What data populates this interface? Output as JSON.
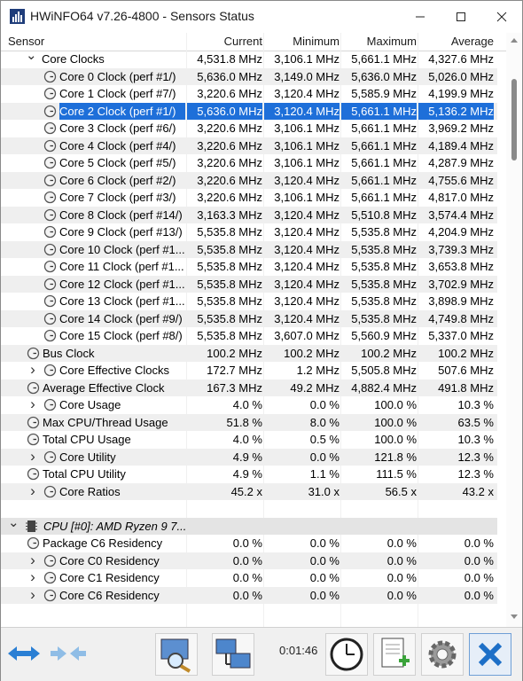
{
  "window": {
    "title": "HWiNFO64 v7.26-4800 - Sensors Status"
  },
  "columns": {
    "sensor": "Sensor",
    "current": "Current",
    "minimum": "Minimum",
    "maximum": "Maximum",
    "average": "Average"
  },
  "rows": [
    {
      "name": "Core Clocks",
      "cur": "4,531.8 MHz",
      "min": "3,106.1 MHz",
      "max": "5,661.1 MHz",
      "avg": "4,327.6 MHz"
    },
    {
      "name": "Core 0 Clock (perf #1/)",
      "cur": "5,636.0 MHz",
      "min": "3,149.0 MHz",
      "max": "5,636.0 MHz",
      "avg": "5,026.0 MHz"
    },
    {
      "name": "Core 1 Clock (perf #7/)",
      "cur": "3,220.6 MHz",
      "min": "3,120.4 MHz",
      "max": "5,585.9 MHz",
      "avg": "4,199.9 MHz"
    },
    {
      "name": "Core 2 Clock (perf #1/)",
      "cur": "5,636.0 MHz",
      "min": "3,120.4 MHz",
      "max": "5,661.1 MHz",
      "avg": "5,136.2 MHz"
    },
    {
      "name": "Core 3 Clock (perf #6/)",
      "cur": "3,220.6 MHz",
      "min": "3,106.1 MHz",
      "max": "5,661.1 MHz",
      "avg": "3,969.2 MHz"
    },
    {
      "name": "Core 4 Clock (perf #4/)",
      "cur": "3,220.6 MHz",
      "min": "3,106.1 MHz",
      "max": "5,661.1 MHz",
      "avg": "4,189.4 MHz"
    },
    {
      "name": "Core 5 Clock (perf #5/)",
      "cur": "3,220.6 MHz",
      "min": "3,106.1 MHz",
      "max": "5,661.1 MHz",
      "avg": "4,287.9 MHz"
    },
    {
      "name": "Core 6 Clock (perf #2/)",
      "cur": "3,220.6 MHz",
      "min": "3,120.4 MHz",
      "max": "5,661.1 MHz",
      "avg": "4,755.6 MHz"
    },
    {
      "name": "Core 7 Clock (perf #3/)",
      "cur": "3,220.6 MHz",
      "min": "3,106.1 MHz",
      "max": "5,661.1 MHz",
      "avg": "4,817.0 MHz"
    },
    {
      "name": "Core 8 Clock (perf #14/)",
      "cur": "3,163.3 MHz",
      "min": "3,120.4 MHz",
      "max": "5,510.8 MHz",
      "avg": "3,574.4 MHz"
    },
    {
      "name": "Core 9 Clock (perf #13/)",
      "cur": "5,535.8 MHz",
      "min": "3,120.4 MHz",
      "max": "5,535.8 MHz",
      "avg": "4,204.9 MHz"
    },
    {
      "name": "Core 10 Clock (perf #1...",
      "cur": "5,535.8 MHz",
      "min": "3,120.4 MHz",
      "max": "5,535.8 MHz",
      "avg": "3,739.3 MHz"
    },
    {
      "name": "Core 11 Clock (perf #1...",
      "cur": "5,535.8 MHz",
      "min": "3,120.4 MHz",
      "max": "5,535.8 MHz",
      "avg": "3,653.8 MHz"
    },
    {
      "name": "Core 12 Clock (perf #1...",
      "cur": "5,535.8 MHz",
      "min": "3,120.4 MHz",
      "max": "5,535.8 MHz",
      "avg": "3,702.9 MHz"
    },
    {
      "name": "Core 13 Clock (perf #1...",
      "cur": "5,535.8 MHz",
      "min": "3,120.4 MHz",
      "max": "5,535.8 MHz",
      "avg": "3,898.9 MHz"
    },
    {
      "name": "Core 14 Clock (perf #9/)",
      "cur": "5,535.8 MHz",
      "min": "3,120.4 MHz",
      "max": "5,535.8 MHz",
      "avg": "4,749.8 MHz"
    },
    {
      "name": "Core 15 Clock (perf #8/)",
      "cur": "5,535.8 MHz",
      "min": "3,607.0 MHz",
      "max": "5,560.9 MHz",
      "avg": "5,337.0 MHz"
    },
    {
      "name": "Bus Clock",
      "cur": "100.2 MHz",
      "min": "100.2 MHz",
      "max": "100.2 MHz",
      "avg": "100.2 MHz"
    },
    {
      "name": "Core Effective Clocks",
      "cur": "172.7 MHz",
      "min": "1.2 MHz",
      "max": "5,505.8 MHz",
      "avg": "507.6 MHz"
    },
    {
      "name": "Average Effective Clock",
      "cur": "167.3 MHz",
      "min": "49.2 MHz",
      "max": "4,882.4 MHz",
      "avg": "491.8 MHz"
    },
    {
      "name": "Core Usage",
      "cur": "4.0 %",
      "min": "0.0 %",
      "max": "100.0 %",
      "avg": "10.3 %"
    },
    {
      "name": "Max CPU/Thread Usage",
      "cur": "51.8 %",
      "min": "8.0 %",
      "max": "100.0 %",
      "avg": "63.5 %"
    },
    {
      "name": "Total CPU Usage",
      "cur": "4.0 %",
      "min": "0.5 %",
      "max": "100.0 %",
      "avg": "10.3 %"
    },
    {
      "name": "Core Utility",
      "cur": "4.9 %",
      "min": "0.0 %",
      "max": "121.8 %",
      "avg": "12.3 %"
    },
    {
      "name": "Total CPU Utility",
      "cur": "4.9 %",
      "min": "1.1 %",
      "max": "111.5 %",
      "avg": "12.3 %"
    },
    {
      "name": "Core Ratios",
      "cur": "45.2 x",
      "min": "31.0 x",
      "max": "56.5 x",
      "avg": "43.2 x"
    },
    {
      "name": "",
      "cur": "",
      "min": "",
      "max": "",
      "avg": ""
    },
    {
      "name": "CPU [#0]: AMD Ryzen 9 7...",
      "cur": "",
      "min": "",
      "max": "",
      "avg": ""
    },
    {
      "name": "Package C6 Residency",
      "cur": "0.0 %",
      "min": "0.0 %",
      "max": "0.0 %",
      "avg": "0.0 %"
    },
    {
      "name": "Core C0 Residency",
      "cur": "0.0 %",
      "min": "0.0 %",
      "max": "0.0 %",
      "avg": "0.0 %"
    },
    {
      "name": "Core C1 Residency",
      "cur": "0.0 %",
      "min": "0.0 %",
      "max": "0.0 %",
      "avg": "0.0 %"
    },
    {
      "name": "Core C6 Residency",
      "cur": "0.0 %",
      "min": "0.0 %",
      "max": "0.0 %",
      "avg": "0.0 %"
    }
  ],
  "toolbar": {
    "timer": "0:01:46"
  }
}
